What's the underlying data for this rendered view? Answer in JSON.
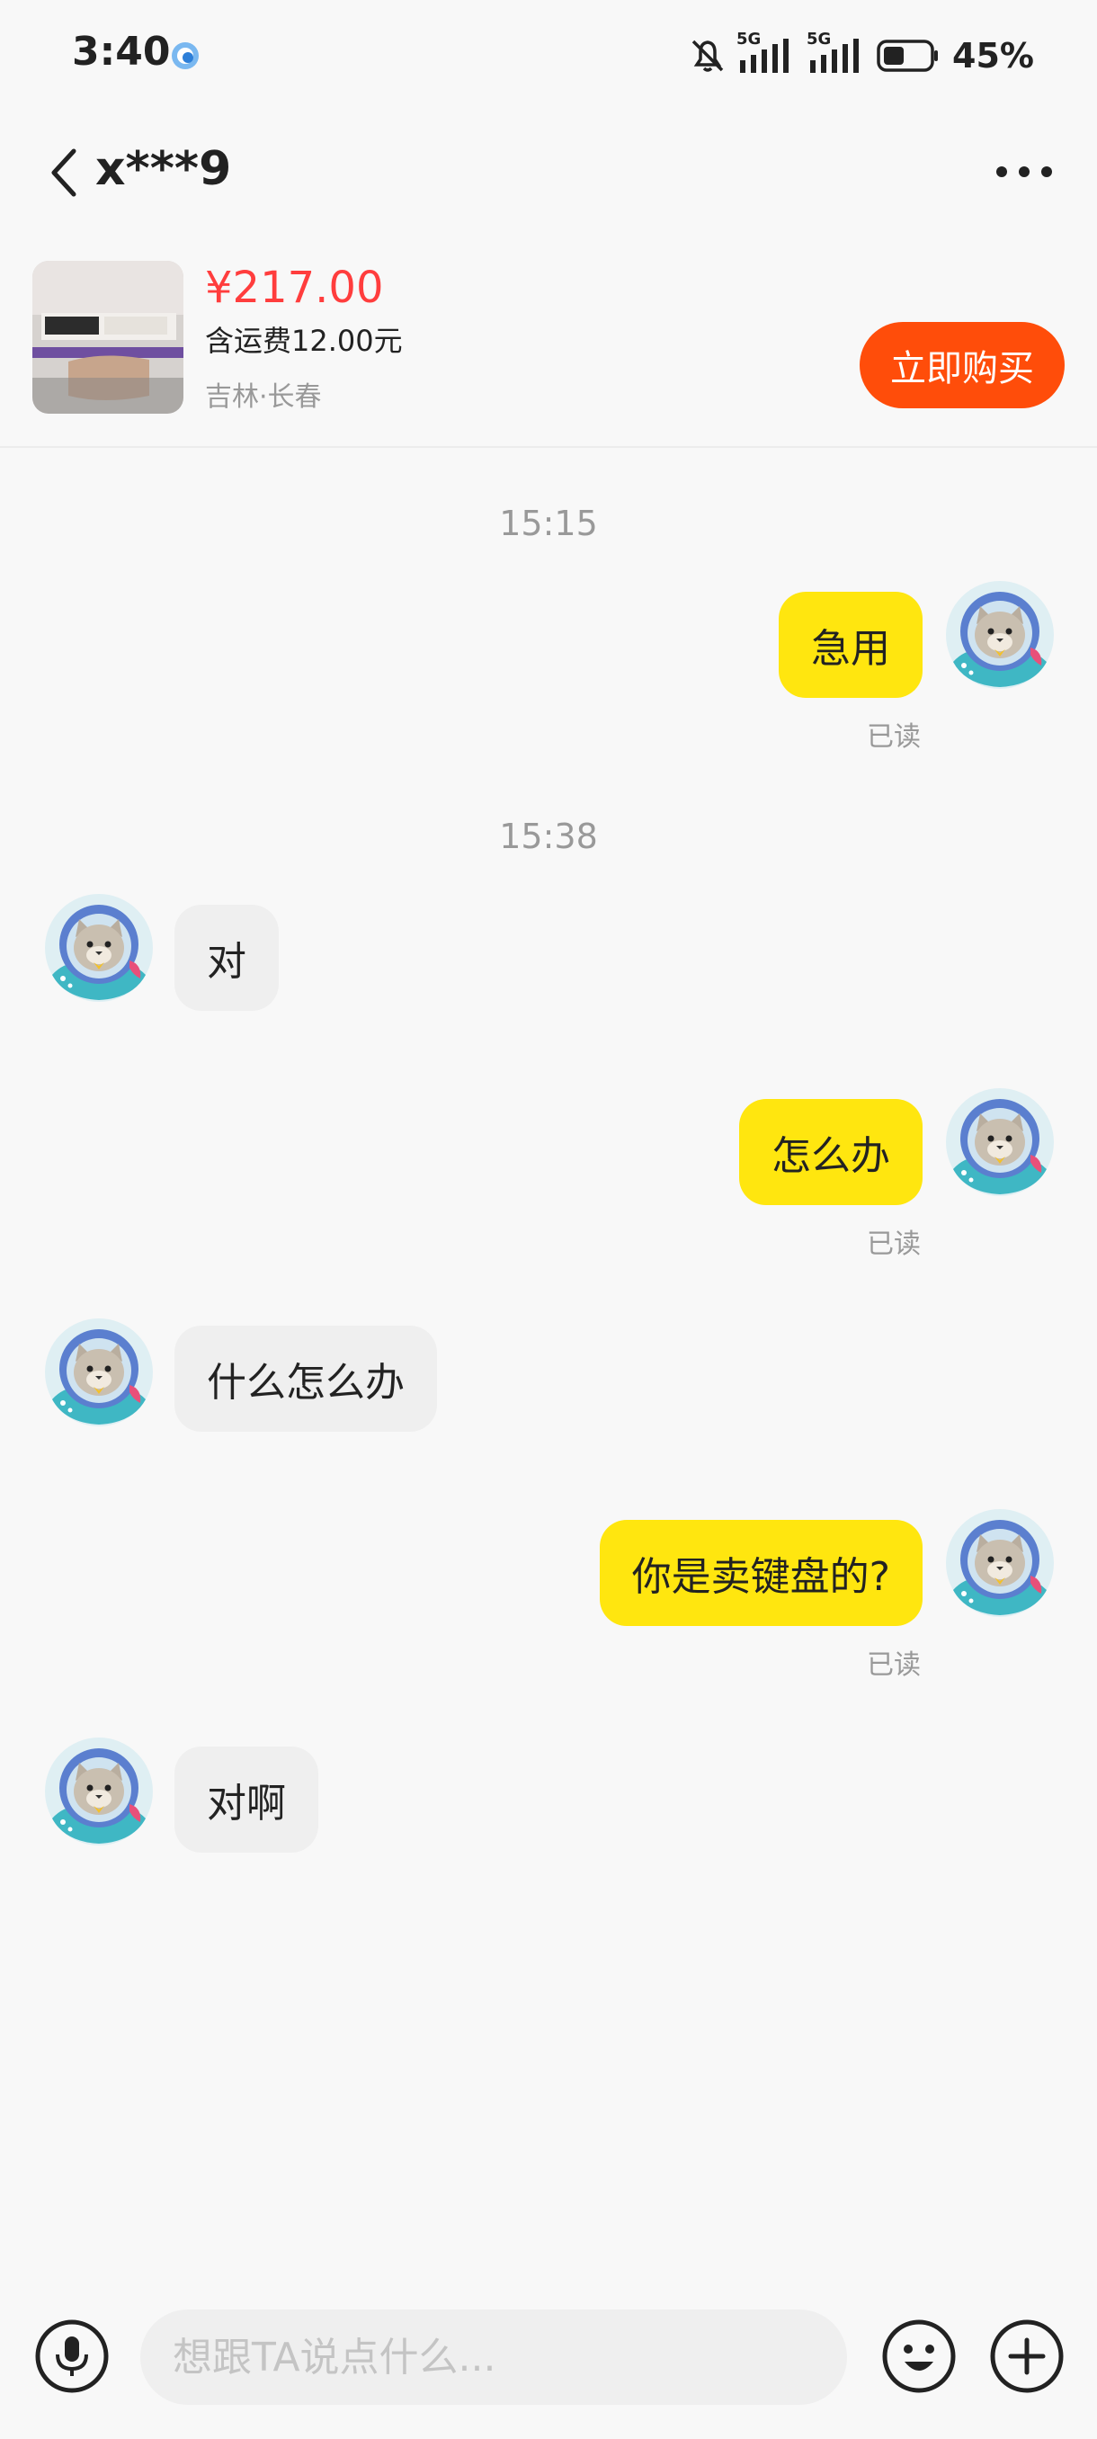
{
  "status_bar": {
    "time": "3:40",
    "network_1": "5G",
    "network_2": "5G",
    "battery": "45%"
  },
  "header": {
    "title": "x***9"
  },
  "product": {
    "price": "¥217.00",
    "shipping": "含运费12.00元",
    "location": "吉林·长春",
    "buy_label": "立即购买"
  },
  "messages": [
    {
      "type": "timestamp",
      "text": "15:15"
    },
    {
      "type": "out",
      "text": "急用",
      "read": "已读"
    },
    {
      "type": "timestamp",
      "text": "15:38"
    },
    {
      "type": "in",
      "text": "对"
    },
    {
      "type": "out",
      "text": "怎么办",
      "read": "已读"
    },
    {
      "type": "in",
      "text": "什么怎么办"
    },
    {
      "type": "out",
      "text": "你是卖键盘的?",
      "read": "已读"
    },
    {
      "type": "in",
      "text": "对啊"
    }
  ],
  "input": {
    "placeholder": "想跟TA说点什么..."
  },
  "colors": {
    "accent": "#ff4d0a",
    "price": "#ff3d3d",
    "outgoing_bubble": "#ffe60f",
    "incoming_bubble": "#efefef"
  },
  "icons": [
    "bell-off-icon",
    "signal-icon",
    "battery-icon",
    "back-icon",
    "more-icon",
    "mic-icon",
    "emoji-icon",
    "plus-icon",
    "cat-avatar"
  ]
}
